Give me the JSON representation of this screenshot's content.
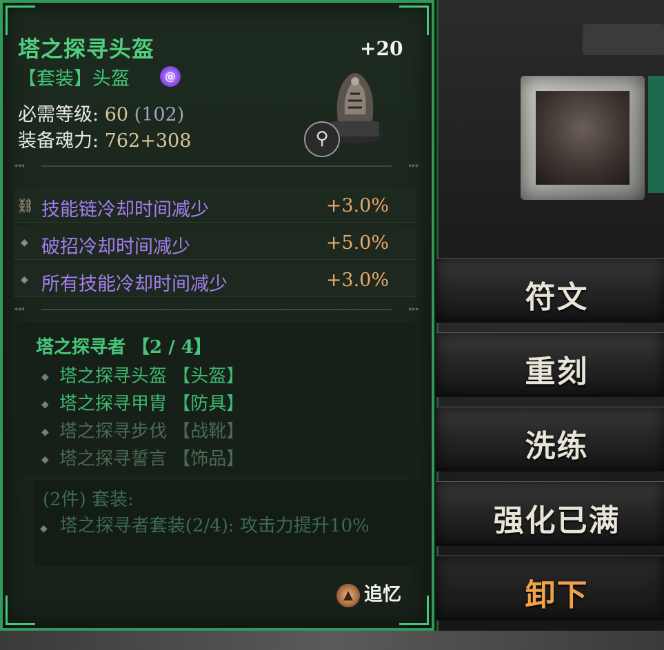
{
  "item": {
    "name": "塔之探寻头盔",
    "enhance_level": "+20",
    "category": "【套装】头盔",
    "set_icon": "swirl-icon",
    "required_level_label": "必需等级:",
    "required_level": "60",
    "required_level_extra": "(102)",
    "power_label": "装备魂力:",
    "power_value": "762+308"
  },
  "affixes": [
    {
      "name": "技能链冷却时间减少",
      "amount": "+3.0%",
      "icon": "chain-icon"
    },
    {
      "name": "破招冷却时间减少",
      "amount": "+5.0%",
      "icon": "diamond-bullet-icon"
    },
    {
      "name": "所有技能冷却时间减少",
      "amount": "+3.0%",
      "icon": "diamond-bullet-icon"
    }
  ],
  "set": {
    "title": "塔之探寻者 【2 / 4】",
    "items": [
      {
        "text": "塔之探寻头盔 【头盔】",
        "owned": true
      },
      {
        "text": "塔之探寻甲胄 【防具】",
        "owned": true
      },
      {
        "text": "塔之探寻步伐 【战靴】",
        "owned": false
      },
      {
        "text": "塔之探寻誓言 【饰品】",
        "owned": false
      }
    ],
    "bonus_header": "(2件) 套装:",
    "bonus_text": "塔之探寻者套装(2/4): 攻击力提升10%"
  },
  "recall": {
    "label": "追忆",
    "icon": "recall-icon"
  },
  "menu": [
    {
      "label": "符文",
      "active": false
    },
    {
      "label": "重刻",
      "active": false
    },
    {
      "label": "洗练",
      "active": false
    },
    {
      "label": "强化已满",
      "active": false
    },
    {
      "label": "卸下",
      "active": true
    }
  ],
  "colors": {
    "border": "#2f9a5a",
    "title": "#4fd07f",
    "affix": "#a57ef0",
    "amount": "#e9a96a",
    "active_menu": "#f0a24a"
  }
}
